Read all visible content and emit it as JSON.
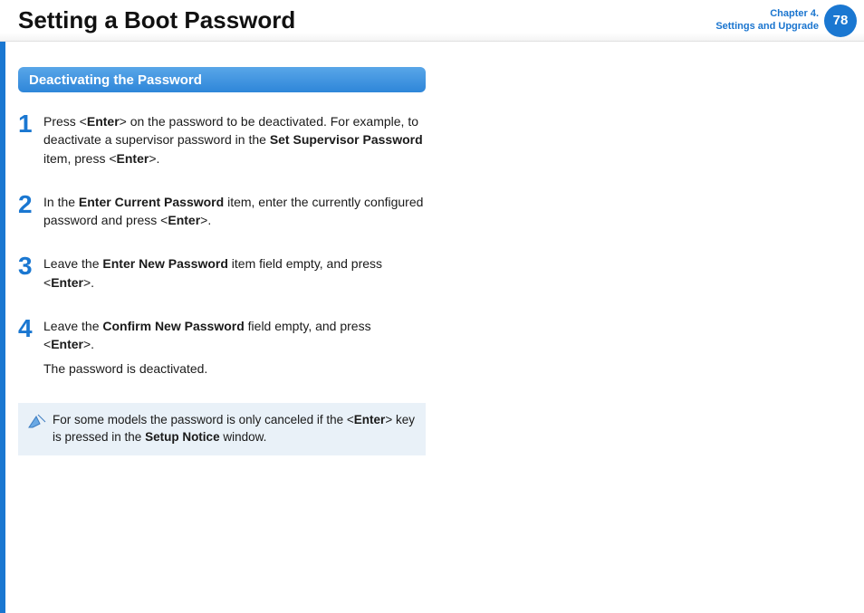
{
  "header": {
    "title": "Setting a Boot Password",
    "chapter_line1": "Chapter 4.",
    "chapter_line2": "Settings and Upgrade",
    "page_number": "78"
  },
  "section": {
    "heading": "Deactivating the Password"
  },
  "steps": {
    "s1": {
      "num": "1",
      "t1": "Press <",
      "enter": "Enter",
      "t2": "> on the password to be deactivated. For example, to deactivate a supervisor password in the ",
      "set_supervisor": "Set Supervisor Password",
      "t3": " item, press <",
      "t4": ">."
    },
    "s2": {
      "num": "2",
      "t1": "In the ",
      "ecp": "Enter Current Password",
      "t2": " item, enter the currently configured password and press <",
      "enter": "Enter",
      "t3": ">."
    },
    "s3": {
      "num": "3",
      "t1": "Leave the ",
      "enp": "Enter New Password",
      "t2": " item field empty, and press <",
      "enter": "Enter",
      "t3": ">."
    },
    "s4": {
      "num": "4",
      "t1": "Leave the ",
      "cnp": "Confirm New Password",
      "t2": " field empty, and press <",
      "enter": "Enter",
      "t3": ">.",
      "final": "The password is deactivated."
    }
  },
  "note": {
    "t1": "For some models the password is only canceled if the <",
    "enter": "Enter",
    "t2": "> key is pressed in the ",
    "setup_notice": "Setup Notice",
    "t3": " window."
  }
}
